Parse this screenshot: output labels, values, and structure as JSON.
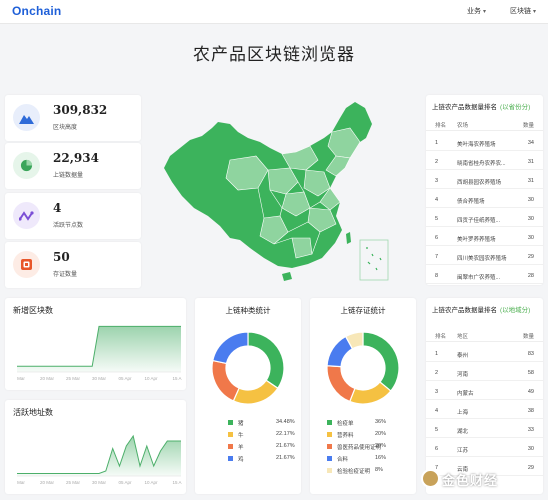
{
  "header": {
    "logo": "Onchain",
    "nav": [
      {
        "label": "业务"
      },
      {
        "label": "区块链"
      }
    ]
  },
  "page_title": "农产品区块链浏览器",
  "stats": [
    {
      "value": "309,832",
      "label": "区块高度",
      "icon": "mountain-icon",
      "color": "#2f6bd8",
      "bg": "#e8eefb"
    },
    {
      "value": "22,934",
      "label": "上链数据量",
      "icon": "pie-icon",
      "color": "#3aa55a",
      "bg": "#e6f5ea"
    },
    {
      "value": "4",
      "label": "活跃节点数",
      "icon": "pulse-icon",
      "color": "#7b4fd6",
      "bg": "#efe9fb"
    },
    {
      "value": "50",
      "label": "存证数量",
      "icon": "certificate-icon",
      "color": "#e8572a",
      "bg": "#fdece5"
    }
  ],
  "map": {
    "colors": {
      "dark": "#3cb35c",
      "light": "#8fd49f"
    }
  },
  "rank1": {
    "title": "上链农产品数据量排名",
    "subtitle": "(以省份分)",
    "headers": [
      "排名",
      "农场",
      "数量"
    ],
    "rows": [
      {
        "rank": "1",
        "name": "美叶海农养殖场",
        "value": "34"
      },
      {
        "rank": "2",
        "name": "晓南省桂舟农养农...",
        "value": "31"
      },
      {
        "rank": "3",
        "name": "西胡县园农养殖场",
        "value": "31"
      },
      {
        "rank": "4",
        "name": "债合养殖场",
        "value": "30"
      },
      {
        "rank": "5",
        "name": "四贡子佳纸养殖...",
        "value": "30"
      },
      {
        "rank": "6",
        "name": "美叶罗养养殖场",
        "value": "30"
      },
      {
        "rank": "7",
        "name": "四川美农园农养殖场",
        "value": "29"
      },
      {
        "rank": "8",
        "name": "闽翠市广农养殖...",
        "value": "28"
      }
    ]
  },
  "rank2": {
    "title": "上链农产品数据量排名",
    "subtitle": "(以地域分)",
    "headers": [
      "排名",
      "地区",
      "数量"
    ],
    "rows": [
      {
        "rank": "1",
        "name": "泰州",
        "value": "83"
      },
      {
        "rank": "2",
        "name": "河南",
        "value": "58"
      },
      {
        "rank": "3",
        "name": "内蒙古",
        "value": "49"
      },
      {
        "rank": "4",
        "name": "上海",
        "value": "38"
      },
      {
        "rank": "5",
        "name": "湖北",
        "value": "33"
      },
      {
        "rank": "6",
        "name": "江苏",
        "value": "30"
      },
      {
        "rank": "7",
        "name": "云南",
        "value": "29"
      }
    ]
  },
  "chart_data": [
    {
      "type": "area",
      "title": "新增区块数",
      "x": [
        "Mar",
        "20 Mar",
        "25 Mar",
        "30 Mar",
        "05 Apr",
        "10 Apr",
        "15 A"
      ],
      "values": [
        0.12,
        0.12,
        0.12,
        0.12,
        0.12,
        0.12,
        0.12,
        0.12,
        0.12,
        0.12,
        0.12,
        0.12,
        0.95,
        0.95,
        0.95,
        0.95,
        0.95,
        0.95,
        0.95,
        0.95,
        0.95,
        0.95,
        0.95,
        0.95,
        0.95
      ],
      "color": "#4caf6a"
    },
    {
      "type": "area",
      "title": "活跃地址数",
      "x": [
        "Mar",
        "20 Mar",
        "25 Mar",
        "30 Mar",
        "05 Apr",
        "10 Apr",
        "15 A"
      ],
      "values": [
        0.05,
        0.05,
        0.05,
        0.05,
        0.05,
        0.05,
        0.05,
        0.05,
        0.05,
        0.05,
        0.05,
        0.05,
        0.05,
        0.1,
        0.55,
        0.2,
        0.6,
        0.8,
        0.2,
        0.6,
        0.2,
        0.5,
        0.7,
        0.7,
        0.7
      ],
      "color": "#4caf6a"
    },
    {
      "type": "pie",
      "title": "上链种类统计",
      "categories": [
        "猪",
        "牛",
        "羊",
        "鸡"
      ],
      "values": [
        34.48,
        22.17,
        21.67,
        21.67
      ],
      "labels": [
        "34.48%",
        "22.17%",
        "21.67%",
        "21.67%"
      ],
      "colors": [
        "#3cb35c",
        "#f5c142",
        "#f0784a",
        "#4a7cef"
      ]
    },
    {
      "type": "pie",
      "title": "上链存证统计",
      "categories": [
        "检疫单",
        "营养料",
        "兽医药品使用证明",
        "合料",
        "检验检疫证明"
      ],
      "values": [
        36,
        20,
        20,
        16,
        8
      ],
      "labels": [
        "36%",
        "20%",
        "20%",
        "16%",
        "8%"
      ],
      "colors": [
        "#3cb35c",
        "#f5c142",
        "#f0784a",
        "#4a7cef",
        "#f7e7b8"
      ]
    }
  ],
  "watermark": "金色财经"
}
